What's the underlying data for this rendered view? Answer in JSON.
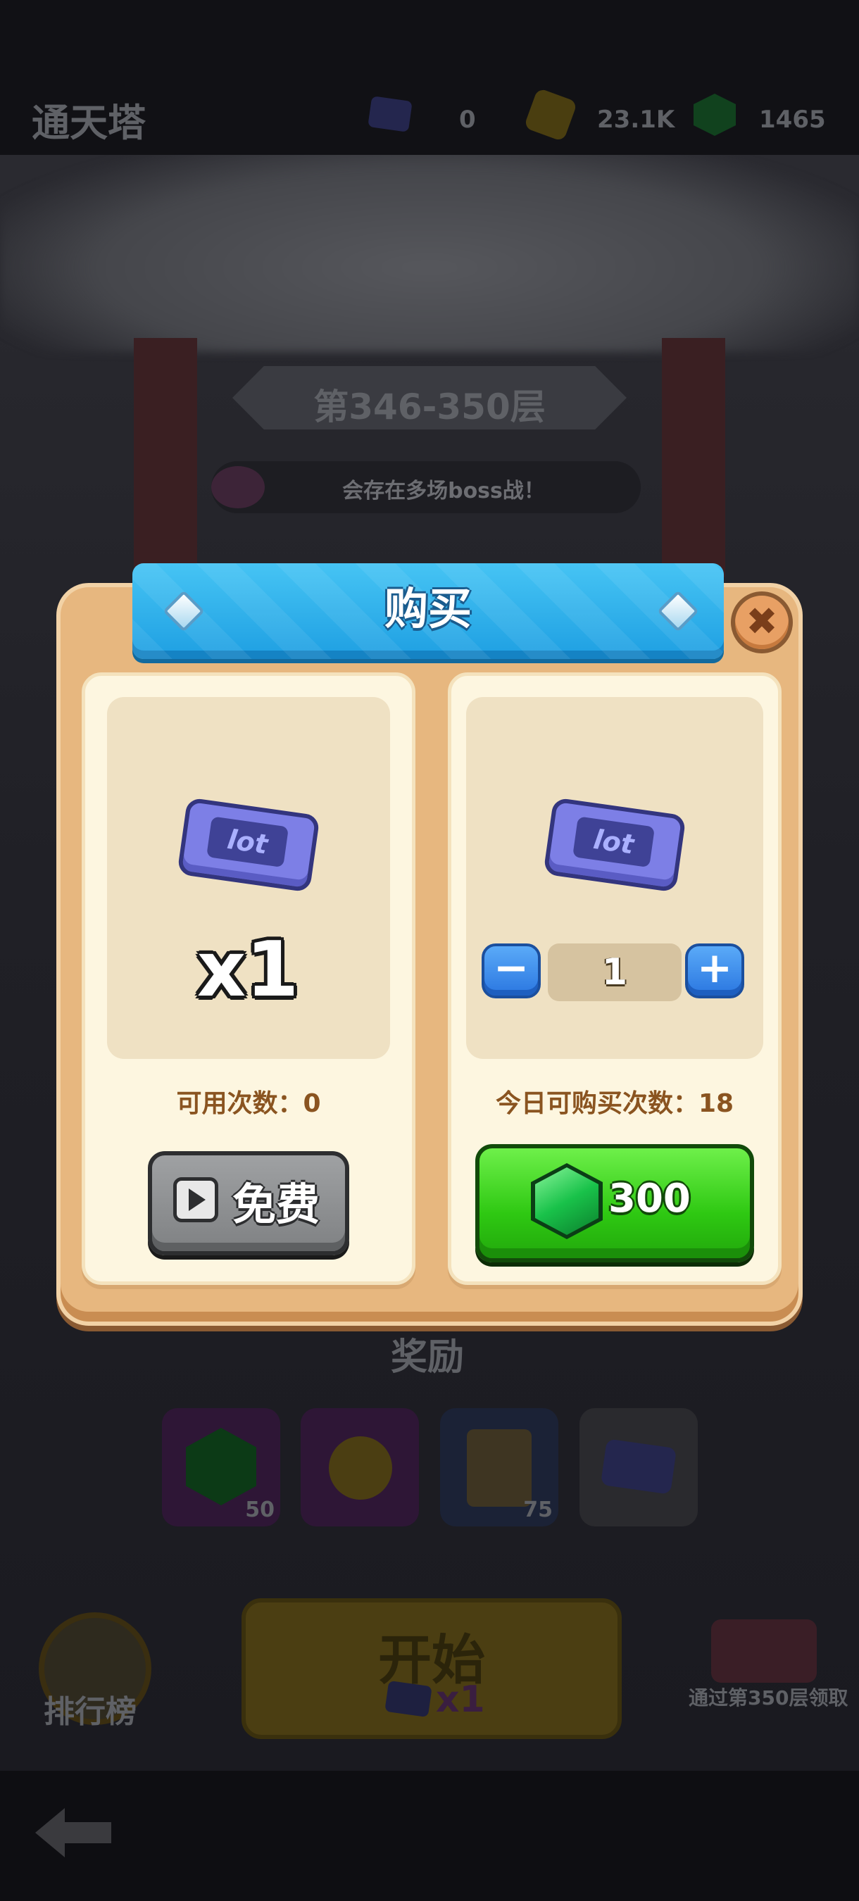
{
  "topbar": {
    "title": "通天塔",
    "tickets": "0",
    "gold": "23.1K",
    "gems": "1465"
  },
  "background": {
    "floor_range": "第346-350层",
    "notice": "会存在多场boss战！",
    "rewards_title": "奖励",
    "rewards": [
      {
        "icon": "green-gem-icon",
        "count": "50"
      },
      {
        "icon": "shovel-icon",
        "count": ""
      },
      {
        "icon": "scroll-icon",
        "count": "75"
      },
      {
        "icon": "ticket-icon",
        "count": ""
      }
    ],
    "start_label": "开始",
    "start_cost": "x1",
    "leaderboard_label": "排行榜",
    "chest_label": "通过第350层领取"
  },
  "modal": {
    "title": "购买",
    "close_icon": "close-icon",
    "free_panel": {
      "item_icon": "ticket-icon",
      "ticket_label": "lot",
      "amount": "x1",
      "info": "可用次数：0",
      "button_label": "免费"
    },
    "buy_panel": {
      "item_icon": "ticket-icon",
      "ticket_label": "lot",
      "quantity": "1",
      "info": "今日可购买次数：18",
      "price": "300"
    }
  },
  "colors": {
    "modal_bg": "#e7b77f",
    "ribbon": "#1e9fe2",
    "buy_button": "#2ec812",
    "free_button": "#8f9193"
  }
}
